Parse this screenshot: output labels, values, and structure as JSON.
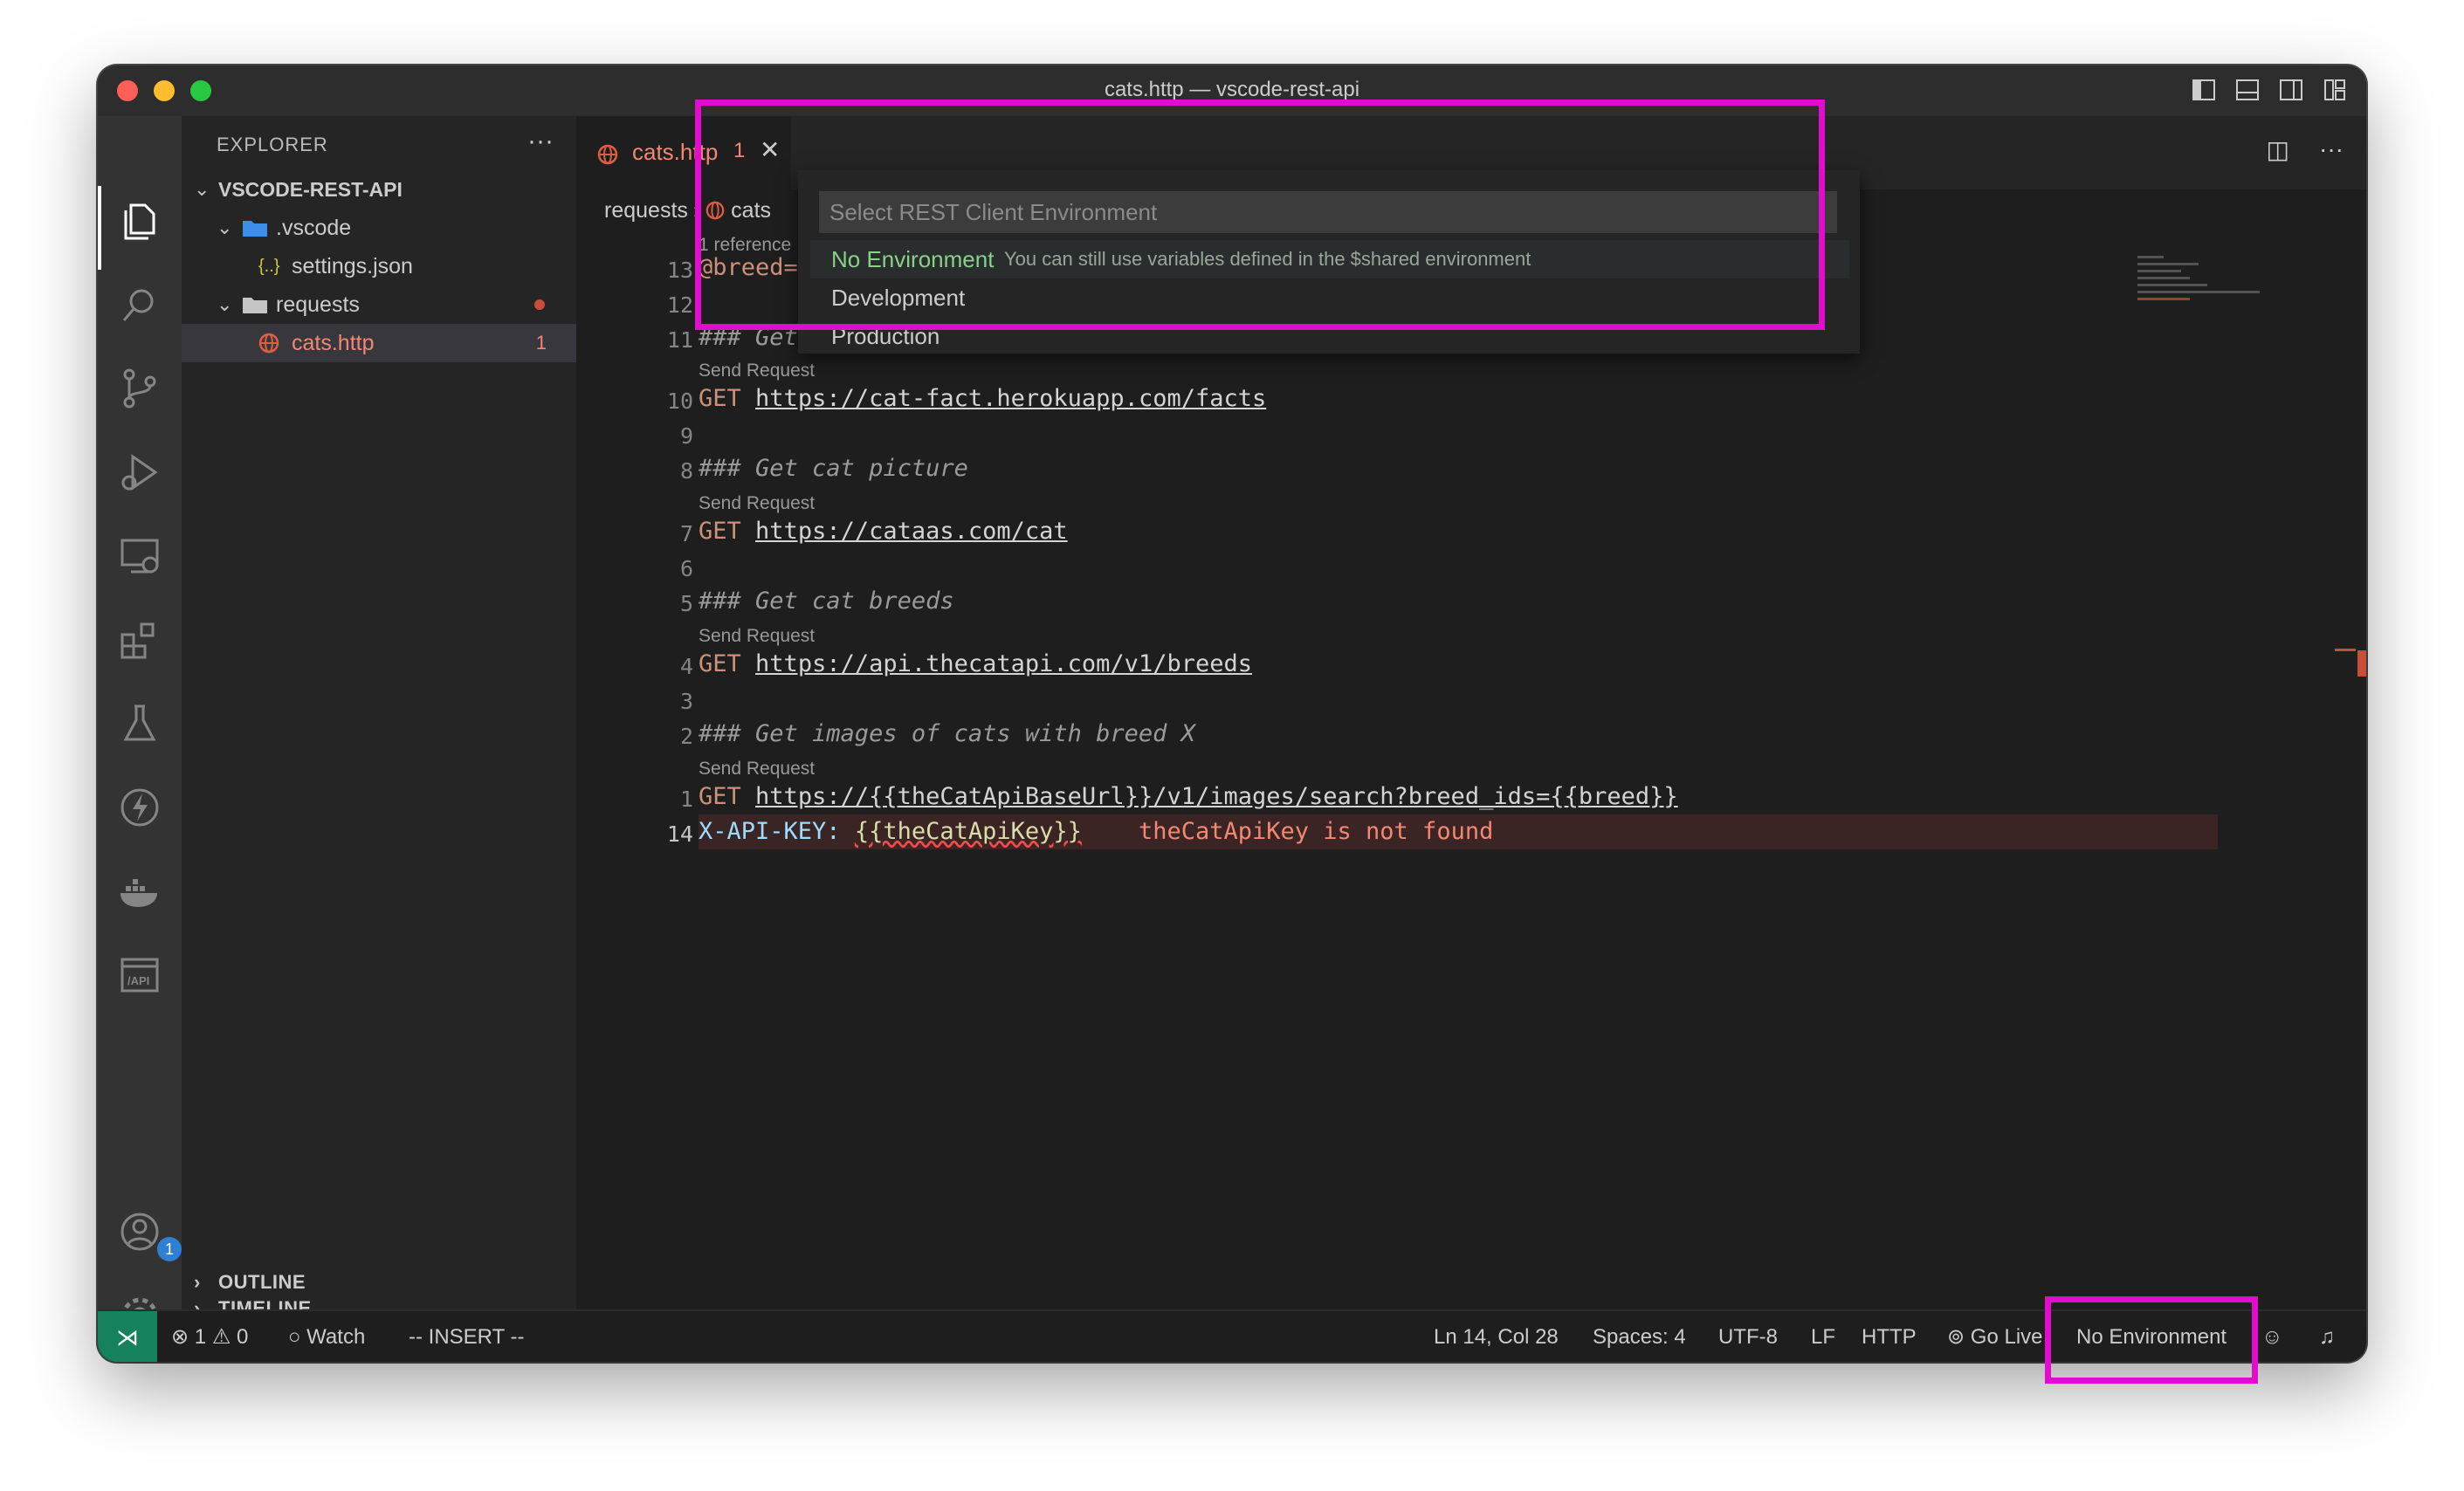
{
  "window": {
    "title": "cats.http — vscode-rest-api"
  },
  "activity_bar": {
    "icons": [
      "files-icon",
      "search-icon",
      "source-control-icon",
      "run-debug-icon",
      "remote-explorer-icon",
      "extensions-icon",
      "testing-icon",
      "thunder-icon",
      "docker-icon",
      "api-icon",
      "account-icon",
      "settings-gear-icon"
    ],
    "account_badge": "1"
  },
  "sidebar": {
    "title": "EXPLORER",
    "more": "···",
    "root": "VSCODE-REST-API",
    "items": [
      {
        "label": ".vscode",
        "type": "folder"
      },
      {
        "label": "settings.json",
        "type": "file"
      },
      {
        "label": "requests",
        "type": "folder"
      },
      {
        "label": "cats.http",
        "type": "file",
        "problems": "1"
      }
    ],
    "sections": [
      "OUTLINE",
      "TIMELINE"
    ]
  },
  "tab": {
    "label": "cats.http",
    "problems": "1",
    "close": "✕"
  },
  "breadcrumb": {
    "folder": "requests",
    "file": "cats"
  },
  "editor": {
    "reference_lens": "1 reference",
    "send_request": "Send Request",
    "lines": [
      {
        "num": "13",
        "text": "@breed=a"
      },
      {
        "num": "12",
        "text": ""
      },
      {
        "num": "11",
        "text": "### Get some facts about cats"
      },
      {
        "num": "10",
        "method": "GET",
        "url": "https://cat-fact.herokuapp.com/facts"
      },
      {
        "num": "9",
        "text": ""
      },
      {
        "num": "8",
        "text": "### Get cat picture"
      },
      {
        "num": "7",
        "method": "GET",
        "url": "https://cataas.com/cat"
      },
      {
        "num": "6",
        "text": ""
      },
      {
        "num": "5",
        "text": "### Get cat breeds"
      },
      {
        "num": "4",
        "method": "GET",
        "url": "https://api.thecatapi.com/v1/breeds"
      },
      {
        "num": "3",
        "text": ""
      },
      {
        "num": "2",
        "text": "### Get images of cats with breed X"
      },
      {
        "num": "1",
        "method": "GET",
        "url": "https://{{theCatApiBaseUrl}}/v1/images/search?breed_ids={{breed}}"
      },
      {
        "num": "14",
        "header": "X-API-KEY:",
        "template": "{{theCatApiKey}}",
        "error": "theCatApiKey is not found"
      }
    ]
  },
  "quick_pick": {
    "placeholder": "Select REST Client Environment",
    "items": [
      {
        "label": "No Environment",
        "description": "You can still use variables defined in the $shared environment"
      },
      {
        "label": "Development"
      },
      {
        "label": "Production"
      }
    ]
  },
  "status_bar": {
    "errors": "1",
    "warnings": "0",
    "watch": "Watch",
    "mode": "-- INSERT --",
    "position": "Ln 14, Col 28",
    "spaces": "Spaces: 4",
    "encoding": "UTF-8",
    "eol": "LF",
    "language": "HTTP",
    "go_live": "Go Live",
    "environment": "No Environment"
  },
  "colors": {
    "highlight": "#e10ccd",
    "error": "#f48771",
    "remote": "#16825d"
  }
}
